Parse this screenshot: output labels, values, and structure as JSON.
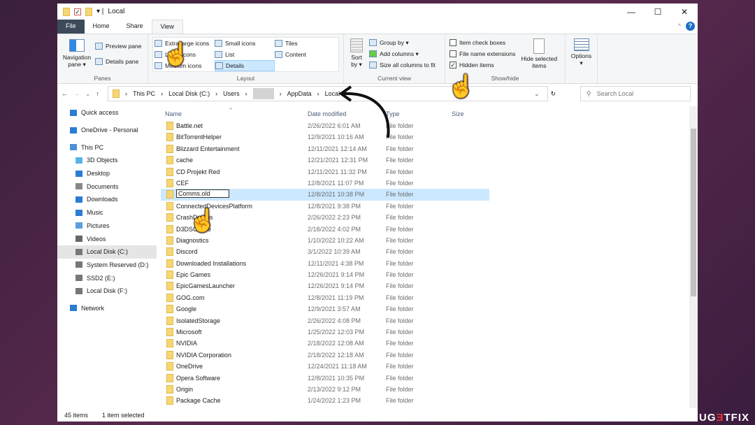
{
  "window": {
    "title": "Local",
    "minimize": "—",
    "maximize": "☐",
    "close": "✕"
  },
  "tabs": [
    "File",
    "Home",
    "Share",
    "View"
  ],
  "ribbon": {
    "panes": {
      "label": "Panes",
      "navigation": "Navigation pane ▾",
      "preview": "Preview pane",
      "details": "Details pane"
    },
    "layout": {
      "label": "Layout",
      "items": [
        "Extra large icons",
        "Large icons",
        "Medium icons",
        "Small icons",
        "List",
        "Details",
        "Tiles",
        "Content"
      ],
      "selected": "Details"
    },
    "current_view": {
      "label": "Current view",
      "sort": "Sort by ▾",
      "group": "Group by ▾",
      "add_columns": "Add columns ▾",
      "size_all": "Size all columns to fit"
    },
    "show_hide": {
      "label": "Show/hide",
      "item_check_boxes": "Item check boxes",
      "file_name_extensions": "File name extensions",
      "hidden_items": "Hidden items",
      "hidden_items_checked": true,
      "hide_selected": "Hide selected items"
    },
    "options": "Options"
  },
  "address": {
    "crumbs": [
      "This PC",
      "Local Disk (C:)",
      "Users",
      "",
      "AppData",
      "Local"
    ],
    "search_placeholder": "Search Local"
  },
  "sidebar": [
    {
      "label": "Quick access",
      "icon": "star-icon",
      "indent": 0
    },
    {
      "label": "OneDrive - Personal",
      "icon": "cloud-icon",
      "indent": 0
    },
    {
      "label": "This PC",
      "icon": "computer-icon",
      "indent": 0
    },
    {
      "label": "3D Objects",
      "icon": "cube-icon",
      "indent": 1
    },
    {
      "label": "Desktop",
      "icon": "desktop-icon",
      "indent": 1
    },
    {
      "label": "Documents",
      "icon": "document-icon",
      "indent": 1
    },
    {
      "label": "Downloads",
      "icon": "download-icon",
      "indent": 1
    },
    {
      "label": "Music",
      "icon": "music-icon",
      "indent": 1
    },
    {
      "label": "Pictures",
      "icon": "picture-icon",
      "indent": 1
    },
    {
      "label": "Videos",
      "icon": "video-icon",
      "indent": 1
    },
    {
      "label": "Local Disk (C:)",
      "icon": "drive-icon",
      "indent": 1,
      "selected": true
    },
    {
      "label": "System Reserved (D:)",
      "icon": "drive-icon",
      "indent": 1
    },
    {
      "label": "SSD2 (E:)",
      "icon": "drive-icon",
      "indent": 1
    },
    {
      "label": "Local Disk (F:)",
      "icon": "drive-icon",
      "indent": 1
    },
    {
      "label": "Network",
      "icon": "network-icon",
      "indent": 0
    }
  ],
  "columns": [
    "Name",
    "Date modified",
    "Type",
    "Size"
  ],
  "files": [
    [
      "Battle.net",
      "2/26/2022 6:01 AM",
      "File folder"
    ],
    [
      "BitTorrentHelper",
      "12/9/2021 10:16 AM",
      "File folder"
    ],
    [
      "Blizzard Entertainment",
      "12/11/2021 12:14 AM",
      "File folder"
    ],
    [
      "cache",
      "12/21/2021 12:31 PM",
      "File folder"
    ],
    [
      "CD Projekt Red",
      "12/11/2021 11:32 PM",
      "File folder"
    ],
    [
      "CEF",
      "12/8/2021 11:07 PM",
      "File folder"
    ],
    [
      "Comms.old",
      "12/8/2021 10:38 PM",
      "File folder"
    ],
    [
      "ConnectedDevicesPlatform",
      "12/8/2021 9:38 PM",
      "File folder"
    ],
    [
      "CrashDumps",
      "2/26/2022 2:23 PM",
      "File folder"
    ],
    [
      "D3DSCache",
      "2/18/2022 4:02 PM",
      "File folder"
    ],
    [
      "Diagnostics",
      "1/10/2022 10:22 AM",
      "File folder"
    ],
    [
      "Discord",
      "3/1/2022 10:39 AM",
      "File folder"
    ],
    [
      "Downloaded Installations",
      "12/11/2021 4:38 PM",
      "File folder"
    ],
    [
      "Epic Games",
      "12/26/2021 9:14 PM",
      "File folder"
    ],
    [
      "EpicGamesLauncher",
      "12/26/2021 9:14 PM",
      "File folder"
    ],
    [
      "GOG.com",
      "12/8/2021 11:19 PM",
      "File folder"
    ],
    [
      "Google",
      "12/9/2021 3:57 AM",
      "File folder"
    ],
    [
      "IsolatedStorage",
      "2/26/2022 4:08 PM",
      "File folder"
    ],
    [
      "Microsoft",
      "1/25/2022 12:03 PM",
      "File folder"
    ],
    [
      "NVIDIA",
      "2/18/2022 12:08 AM",
      "File folder"
    ],
    [
      "NVIDIA Corporation",
      "2/18/2022 12:18 AM",
      "File folder"
    ],
    [
      "OneDrive",
      "12/24/2021 11:18 AM",
      "File folder"
    ],
    [
      "Opera Software",
      "12/8/2021 10:35 PM",
      "File folder"
    ],
    [
      "Origin",
      "2/13/2022 9:12 PM",
      "File folder"
    ],
    [
      "Package Cache",
      "1/24/2022 1:23 PM",
      "File folder"
    ]
  ],
  "selected_file": "Comms.old",
  "status": {
    "count": "45 items",
    "selected": "1 item selected"
  },
  "watermark": "UGETFIX"
}
